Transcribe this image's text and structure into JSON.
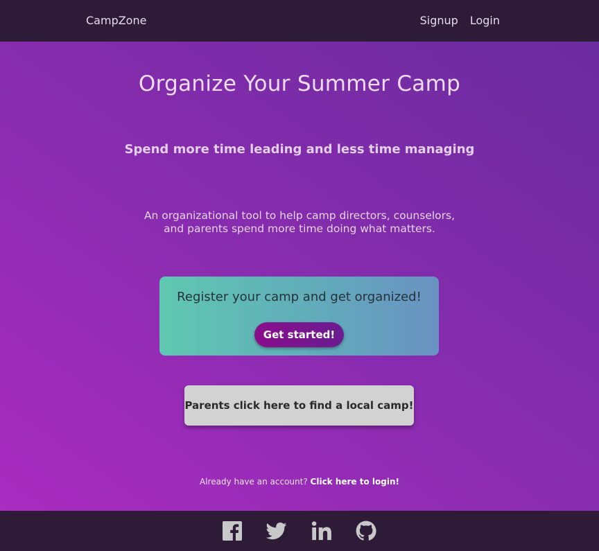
{
  "navbar": {
    "brand": "CampZone",
    "links": [
      {
        "label": "Signup"
      },
      {
        "label": "Login"
      }
    ]
  },
  "hero": {
    "headline": "Organize Your Summer Camp",
    "subheadline": "Spend more time leading and less time managing",
    "description": "An organizational tool to help camp directors, counselors, and parents spend more time doing what matters."
  },
  "register_card": {
    "text": "Register your camp and get organized!",
    "button_label": "Get started!"
  },
  "parents_button_label": "Parents click here to find a local camp!",
  "login_prompt": {
    "text": "Already have an account?",
    "link_label": "Click here to login!"
  },
  "footer": {
    "icons": [
      "facebook-icon",
      "twitter-icon",
      "linkedin-icon",
      "github-icon"
    ]
  },
  "colors": {
    "navbar_bg": "#2d1b38",
    "hero_gradient_start": "#aa2cc0",
    "hero_gradient_end": "#6a2c9e",
    "card_gradient_start": "#5fc8b0",
    "card_gradient_end": "#6a92c2",
    "cta_button": "#8a0d8c",
    "parents_button": "#d2d2d2"
  }
}
